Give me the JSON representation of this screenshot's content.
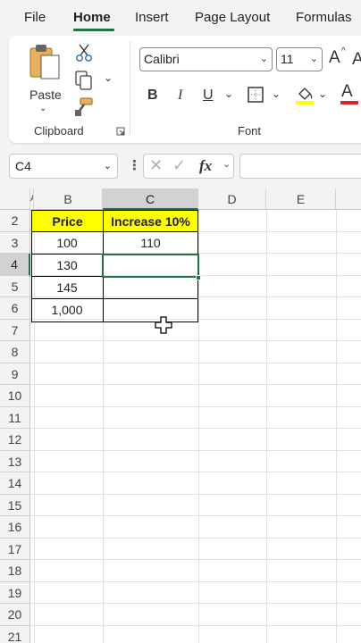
{
  "menu": {
    "file": "File",
    "home": "Home",
    "insert": "Insert",
    "page_layout": "Page Layout",
    "formulas": "Formulas"
  },
  "clipboard": {
    "paste_label": "Paste",
    "group_label": "Clipboard",
    "icons": [
      "paste-icon",
      "cut-icon",
      "copy-icon",
      "format-painter-icon",
      "dialog-launcher-icon"
    ]
  },
  "font": {
    "group_label": "Font",
    "font_name": "Calibri",
    "font_size": "11",
    "grow_label": "A",
    "bold": "B",
    "italic": "I",
    "underline": "U",
    "font_color_label": "A",
    "fill_color": "#ffff00",
    "font_color": "#e02020"
  },
  "formula_bar": {
    "name_box": "C4",
    "fx": "fx"
  },
  "columns": [
    "A",
    "B",
    "C",
    "D",
    "E"
  ],
  "rows": [
    "2",
    "3",
    "4",
    "5",
    "6",
    "7",
    "8",
    "9",
    "10",
    "11",
    "12",
    "13",
    "14",
    "15",
    "16",
    "17",
    "18",
    "19",
    "20",
    "21"
  ],
  "table": {
    "headers": [
      "Price",
      "Increase 10%"
    ],
    "rows": [
      [
        "100",
        "110"
      ],
      [
        "130",
        ""
      ],
      [
        "145",
        ""
      ],
      [
        "1,000",
        ""
      ]
    ]
  },
  "selection": {
    "active_cell": "C4",
    "accent": "#217346"
  }
}
